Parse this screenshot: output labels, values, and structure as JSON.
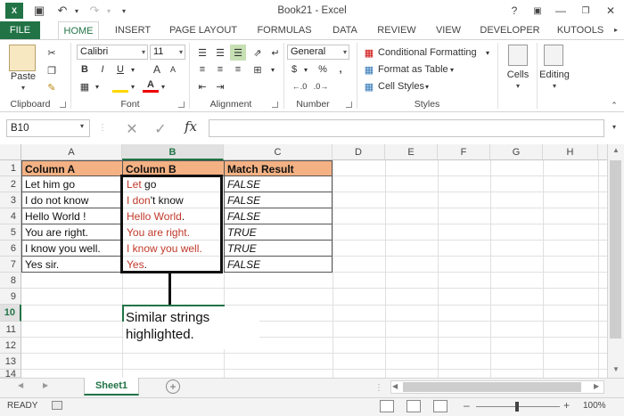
{
  "window": {
    "title": "Book21 - Excel",
    "help": "?"
  },
  "ribbon_tabs": [
    "FILE",
    "HOME",
    "INSERT",
    "PAGE LAYOUT",
    "FORMULAS",
    "DATA",
    "REVIEW",
    "VIEW",
    "DEVELOPER",
    "KUTOOLS"
  ],
  "clipboard": {
    "paste": "Paste",
    "label": "Clipboard"
  },
  "font": {
    "name": "Calibri",
    "size": "11",
    "bold": "B",
    "italic": "I",
    "underline": "U",
    "grow": "A",
    "shrink": "A",
    "color_a": "A",
    "label": "Font"
  },
  "alignment": {
    "label": "Alignment"
  },
  "number": {
    "format": "General",
    "currency": "$",
    "percent": "%",
    "comma": ",",
    "label": "Number"
  },
  "styles": {
    "conditional": "Conditional Formatting",
    "table": "Format as Table",
    "cell": "Cell Styles",
    "label": "Styles"
  },
  "cells": {
    "label": "Cells"
  },
  "editing": {
    "label": "Editing"
  },
  "formula_bar": {
    "name_box": "B10",
    "fx": "fx",
    "cancel": "✕",
    "enter": "✓",
    "value": ""
  },
  "columns": [
    "A",
    "B",
    "C",
    "D",
    "E",
    "F",
    "G",
    "H"
  ],
  "rows": [
    "1",
    "2",
    "3",
    "4",
    "5",
    "6",
    "7",
    "8",
    "9",
    "10",
    "11",
    "12",
    "13",
    "14"
  ],
  "table": {
    "headers": [
      "Column A",
      "Column B",
      "Match Result"
    ],
    "col_a": [
      "Let him go",
      "I do not know",
      "Hello World !",
      "You are right.",
      "I know you well.",
      "Yes sir."
    ],
    "col_b": [
      {
        "red": "Let",
        "rest": " go"
      },
      {
        "red": "I don",
        "rest": "'t know"
      },
      {
        "red": "Hello World",
        "rest": "."
      },
      {
        "red": "You are right.",
        "rest": ""
      },
      {
        "red": "I know you well.",
        "rest": ""
      },
      {
        "red": "Yes",
        "rest": "."
      }
    ],
    "col_c": [
      "FALSE",
      "FALSE",
      "FALSE",
      "TRUE",
      "TRUE",
      "FALSE"
    ]
  },
  "callout": {
    "line1": "Similar strings",
    "line2": "highlighted."
  },
  "sheet": {
    "tab": "Sheet1",
    "add": "+"
  },
  "status": {
    "ready": "READY",
    "zoom": "100%"
  },
  "colors": {
    "accent": "#217346",
    "header_fill": "#f4b183",
    "highlight_text": "#c0392b"
  }
}
